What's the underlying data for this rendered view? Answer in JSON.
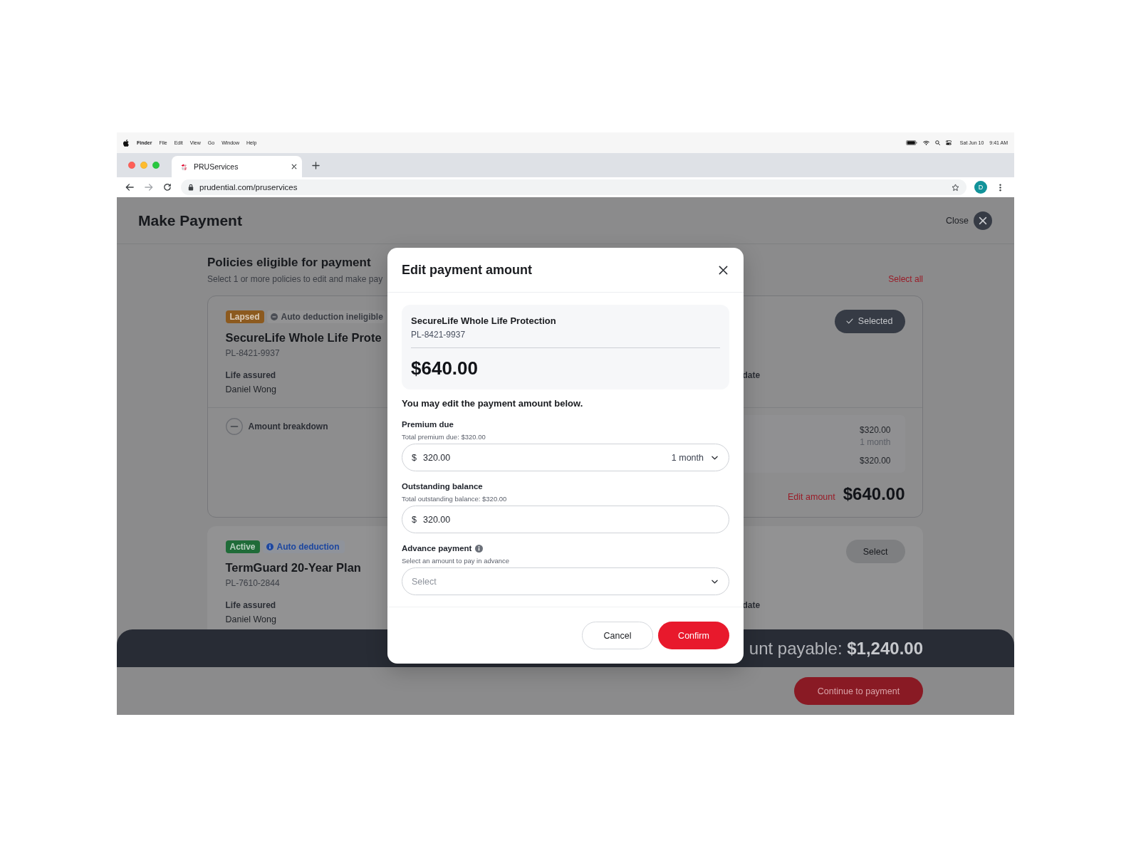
{
  "menubar": {
    "app_name": "Finder",
    "menus": [
      "File",
      "Edit",
      "View",
      "Go",
      "Window",
      "Help"
    ],
    "date": "Sat Jun 10",
    "time": "9:41 AM"
  },
  "browser": {
    "tabs": [
      {
        "title": "PRUServices",
        "selected": true
      }
    ],
    "url": "prudential.com/pruservices",
    "profile_initial": "D"
  },
  "page": {
    "title": "Make Payment",
    "close_label": "Close"
  },
  "policies": {
    "title": "Policies eligible for payment",
    "subtitle": "Select 1 or more policies to edit and make pay",
    "select_all": "Select all",
    "items": [
      {
        "status": {
          "label": "Lapsed",
          "color": "#8c5a1f"
        },
        "deduction": {
          "kind": "ineligible",
          "label": "Auto deduction ineligible"
        },
        "name": "SecureLife Whole Life Prote",
        "number": "PL-8421-9937",
        "life_assured_label": "Life assured",
        "life_assured": "Daniel Wong",
        "column_2_label": "date",
        "selected": true,
        "select_label": "Selected",
        "breakdown": {
          "label": "Amount breakdown",
          "expanded": true,
          "lines": [
            {
              "amount": "$320.00",
              "period": "1 month"
            },
            {
              "amount": "$320.00"
            }
          ]
        },
        "edit_label": "Edit amount",
        "total": "$640.00"
      },
      {
        "status": {
          "label": "Active",
          "color": "#1f6b38"
        },
        "deduction": {
          "kind": "info",
          "label": "Auto deduction"
        },
        "name": "TermGuard 20-Year Plan",
        "number": "PL-7610-2844",
        "life_assured_label": "Life assured",
        "life_assured": "Daniel Wong",
        "column_2_label": "date",
        "selected": false,
        "select_label": "Select"
      }
    ]
  },
  "summary_bar": {
    "text": "unt payable: **$1,240.00**"
  },
  "continue_button": "Continue to payment",
  "modal": {
    "title": "Edit payment amount",
    "policy_name": "SecureLife Whole Life Protection",
    "policy_number": "PL-8421-9937",
    "amount": "$640.00",
    "instruction": "You may edit the payment amount below.",
    "fields": [
      {
        "kind": "amount",
        "label": "Premium due",
        "info": false,
        "hint": "Total premium due: $320.00",
        "currency": "$",
        "value": "320.00",
        "period": "1 month"
      },
      {
        "kind": "amount",
        "label": "Outstanding balance",
        "info": false,
        "hint": "Total outstanding balance: $320.00",
        "currency": "$",
        "value": "320.00"
      },
      {
        "kind": "select",
        "label": "Advance payment",
        "info": true,
        "hint": "Select an amount to pay in advance",
        "placeholder": "Select"
      }
    ],
    "buttons": [
      {
        "kind": "secondary",
        "label": "Cancel"
      },
      {
        "kind": "primary",
        "label": "Confirm"
      }
    ]
  }
}
